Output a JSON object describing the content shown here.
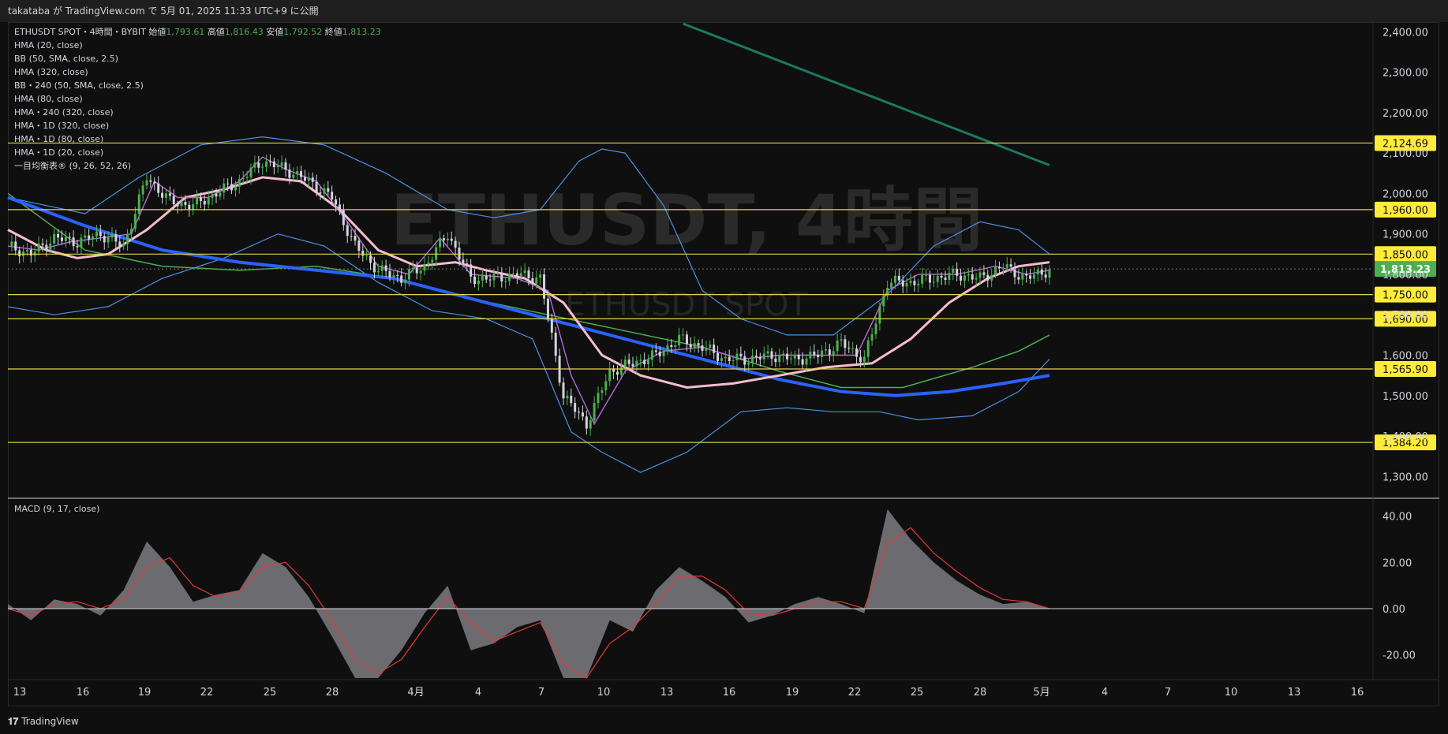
{
  "header": {
    "publisher_line": "takataba が TradingView.com で 5月 01, 2025 11:33 UTC+9 に公開"
  },
  "footer": {
    "brand": "TradingView"
  },
  "legend": {
    "symbol_line": "ETHUSDT SPOT・4時間・BYBIT",
    "open_label": "始値",
    "open": "1,793.61",
    "high_label": "高値",
    "high": "1,816.43",
    "low_label": "安値",
    "low": "1,792.52",
    "close_label": "終値",
    "close": "1,813.23",
    "indicators": [
      "HMA (20, close)",
      "BB (50, SMA, close, 2.5)",
      "HMA (320, close)",
      "BB・240 (50, SMA, close, 2.5)",
      "HMA (80, close)",
      "HMA・240 (320, close)",
      "HMA・1D (320, close)",
      "HMA・1D (80, close)",
      "HMA・1D (20, close)",
      "一目均衡表® (9, 26, 52, 26)"
    ]
  },
  "watermark": {
    "big": "ETHUSDT, 4時間",
    "small": "ETHUSDT SPOT"
  },
  "colors": {
    "up": "#26a69a",
    "upbody": "#4caf50",
    "down": "#d1d4dc",
    "hma20": "#b36ad6",
    "hma80_pink": "#f8bbd0",
    "hma320_blue": "#2962ff",
    "bb": "#4a90e2",
    "green_ma": "#4caf50",
    "teal_line": "#1b7a63",
    "hline": "#e6d54a",
    "price_label_bg": "#ffeb3b",
    "current_bg": "#4caf50"
  },
  "chart_data": [
    {
      "type": "candlestick",
      "title": "ETHUSDT SPOT・4時間・BYBIT",
      "ylim": [
        1250,
        2420
      ],
      "y_ticks": [
        "2,400.00",
        "2,300.00",
        "2,200.00",
        "2,100.00",
        "2,000.00",
        "1,900.00",
        "1,800.00",
        "1,700.00",
        "1,600.00",
        "1,500.00",
        "1,400.00",
        "1,300.00"
      ],
      "y_tick_values": [
        2400,
        2300,
        2200,
        2100,
        2000,
        1900,
        1800,
        1700,
        1600,
        1500,
        1400,
        1300
      ],
      "x_ticks": [
        "13",
        "16",
        "19",
        "22",
        "25",
        "28",
        "4月",
        "4",
        "7",
        "10",
        "13",
        "16",
        "19",
        "22",
        "25",
        "28",
        "5月",
        "4",
        "7",
        "10",
        "13",
        "16"
      ],
      "horizontal_levels": [
        {
          "value": 2124.69,
          "label": "2,124.69"
        },
        {
          "value": 1960.0,
          "label": "1,960.00"
        },
        {
          "value": 1850.0,
          "label": "1,850.00"
        },
        {
          "value": 1750.0,
          "label": "1,750.00"
        },
        {
          "value": 1690.0,
          "label": "1,690.00"
        },
        {
          "value": 1565.9,
          "label": "1,565.90"
        },
        {
          "value": 1384.2,
          "label": "1,384.20"
        }
      ],
      "current_price": {
        "value": 1813.23,
        "label": "1,813.23"
      },
      "close_path": [
        [
          0,
          1870
        ],
        [
          6,
          1850
        ],
        [
          12,
          1890
        ],
        [
          18,
          1880
        ],
        [
          24,
          1900
        ],
        [
          30,
          1870
        ],
        [
          36,
          2040
        ],
        [
          42,
          1980
        ],
        [
          48,
          1970
        ],
        [
          54,
          2000
        ],
        [
          60,
          2030
        ],
        [
          66,
          2080
        ],
        [
          72,
          2060
        ],
        [
          78,
          2030
        ],
        [
          84,
          1990
        ],
        [
          90,
          1870
        ],
        [
          96,
          1810
        ],
        [
          102,
          1790
        ],
        [
          108,
          1820
        ],
        [
          114,
          1900
        ],
        [
          120,
          1790
        ],
        [
          126,
          1790
        ],
        [
          132,
          1800
        ],
        [
          138,
          1790
        ],
        [
          144,
          1500
        ],
        [
          150,
          1430
        ],
        [
          156,
          1560
        ],
        [
          162,
          1580
        ],
        [
          168,
          1600
        ],
        [
          174,
          1640
        ],
        [
          180,
          1620
        ],
        [
          186,
          1590
        ],
        [
          192,
          1590
        ],
        [
          198,
          1600
        ],
        [
          204,
          1590
        ],
        [
          210,
          1600
        ],
        [
          216,
          1630
        ],
        [
          222,
          1590
        ],
        [
          228,
          1780
        ],
        [
          234,
          1780
        ],
        [
          240,
          1790
        ],
        [
          246,
          1800
        ],
        [
          252,
          1790
        ],
        [
          258,
          1820
        ],
        [
          264,
          1790
        ],
        [
          270,
          1812
        ]
      ],
      "hma20_path": [
        [
          0,
          1870
        ],
        [
          8,
          1860
        ],
        [
          16,
          1880
        ],
        [
          24,
          1890
        ],
        [
          32,
          1900
        ],
        [
          38,
          2030
        ],
        [
          44,
          1990
        ],
        [
          52,
          1990
        ],
        [
          60,
          2030
        ],
        [
          66,
          2090
        ],
        [
          72,
          2060
        ],
        [
          80,
          2030
        ],
        [
          88,
          1930
        ],
        [
          96,
          1820
        ],
        [
          104,
          1800
        ],
        [
          112,
          1890
        ],
        [
          120,
          1800
        ],
        [
          132,
          1790
        ],
        [
          140,
          1760
        ],
        [
          146,
          1550
        ],
        [
          152,
          1430
        ],
        [
          160,
          1560
        ],
        [
          170,
          1610
        ],
        [
          180,
          1620
        ],
        [
          190,
          1590
        ],
        [
          200,
          1600
        ],
        [
          210,
          1600
        ],
        [
          220,
          1600
        ],
        [
          228,
          1760
        ],
        [
          236,
          1800
        ],
        [
          246,
          1800
        ],
        [
          256,
          1820
        ],
        [
          264,
          1800
        ],
        [
          270,
          1810
        ]
      ],
      "hma80_path": [
        [
          0,
          1910
        ],
        [
          10,
          1860
        ],
        [
          18,
          1840
        ],
        [
          26,
          1850
        ],
        [
          36,
          1910
        ],
        [
          46,
          1990
        ],
        [
          56,
          2010
        ],
        [
          66,
          2040
        ],
        [
          76,
          2030
        ],
        [
          86,
          1960
        ],
        [
          96,
          1860
        ],
        [
          106,
          1820
        ],
        [
          116,
          1830
        ],
        [
          124,
          1810
        ],
        [
          134,
          1790
        ],
        [
          144,
          1730
        ],
        [
          154,
          1600
        ],
        [
          164,
          1550
        ],
        [
          176,
          1520
        ],
        [
          188,
          1530
        ],
        [
          200,
          1550
        ],
        [
          212,
          1570
        ],
        [
          224,
          1580
        ],
        [
          234,
          1640
        ],
        [
          244,
          1730
        ],
        [
          254,
          1790
        ],
        [
          262,
          1820
        ],
        [
          270,
          1830
        ]
      ],
      "hma320_path": [
        [
          0,
          1990
        ],
        [
          20,
          1920
        ],
        [
          40,
          1860
        ],
        [
          60,
          1830
        ],
        [
          80,
          1810
        ],
        [
          100,
          1790
        ],
        [
          120,
          1740
        ],
        [
          140,
          1690
        ],
        [
          160,
          1640
        ],
        [
          180,
          1590
        ],
        [
          200,
          1540
        ],
        [
          216,
          1510
        ],
        [
          230,
          1500
        ],
        [
          244,
          1510
        ],
        [
          258,
          1530
        ],
        [
          270,
          1550
        ]
      ],
      "green_ma_path": [
        [
          0,
          2000
        ],
        [
          20,
          1860
        ],
        [
          40,
          1820
        ],
        [
          60,
          1810
        ],
        [
          80,
          1820
        ],
        [
          100,
          1790
        ],
        [
          120,
          1740
        ],
        [
          140,
          1700
        ],
        [
          160,
          1660
        ],
        [
          180,
          1620
        ],
        [
          200,
          1560
        ],
        [
          216,
          1520
        ],
        [
          232,
          1520
        ],
        [
          250,
          1570
        ],
        [
          262,
          1610
        ],
        [
          270,
          1650
        ]
      ],
      "bb_upper_path": [
        [
          0,
          1990
        ],
        [
          20,
          1950
        ],
        [
          34,
          2040
        ],
        [
          50,
          2120
        ],
        [
          66,
          2140
        ],
        [
          82,
          2120
        ],
        [
          98,
          2050
        ],
        [
          114,
          1960
        ],
        [
          126,
          1940
        ],
        [
          138,
          1960
        ],
        [
          148,
          2080
        ],
        [
          154,
          2110
        ],
        [
          160,
          2100
        ],
        [
          170,
          1970
        ],
        [
          180,
          1760
        ],
        [
          190,
          1690
        ],
        [
          202,
          1650
        ],
        [
          214,
          1650
        ],
        [
          228,
          1750
        ],
        [
          240,
          1870
        ],
        [
          252,
          1930
        ],
        [
          262,
          1910
        ],
        [
          270,
          1850
        ]
      ],
      "bb_lower_path": [
        [
          0,
          1720
        ],
        [
          12,
          1700
        ],
        [
          26,
          1720
        ],
        [
          40,
          1790
        ],
        [
          56,
          1840
        ],
        [
          70,
          1900
        ],
        [
          82,
          1870
        ],
        [
          96,
          1780
        ],
        [
          110,
          1710
        ],
        [
          124,
          1690
        ],
        [
          136,
          1640
        ],
        [
          146,
          1410
        ],
        [
          154,
          1360
        ],
        [
          164,
          1310
        ],
        [
          176,
          1360
        ],
        [
          190,
          1460
        ],
        [
          202,
          1470
        ],
        [
          214,
          1460
        ],
        [
          226,
          1460
        ],
        [
          236,
          1440
        ],
        [
          250,
          1450
        ],
        [
          262,
          1510
        ],
        [
          270,
          1590
        ]
      ],
      "teal_line": [
        [
          175,
          2420
        ],
        [
          270,
          2070
        ]
      ],
      "macd_ylim": [
        -30,
        45
      ],
      "macd_ticks": [
        "40.00",
        "20.00",
        "0.00",
        "-20.00"
      ],
      "macd_tick_values": [
        40,
        20,
        0,
        -20
      ],
      "macd_hist": [
        [
          0,
          2
        ],
        [
          6,
          -5
        ],
        [
          12,
          4
        ],
        [
          18,
          2
        ],
        [
          24,
          -3
        ],
        [
          30,
          8
        ],
        [
          36,
          29
        ],
        [
          42,
          18
        ],
        [
          48,
          3
        ],
        [
          54,
          6
        ],
        [
          60,
          8
        ],
        [
          66,
          24
        ],
        [
          72,
          18
        ],
        [
          78,
          5
        ],
        [
          84,
          -12
        ],
        [
          90,
          -30
        ],
        [
          96,
          -30
        ],
        [
          102,
          -18
        ],
        [
          108,
          -2
        ],
        [
          114,
          10
        ],
        [
          120,
          -18
        ],
        [
          126,
          -15
        ],
        [
          132,
          -8
        ],
        [
          138,
          -5
        ],
        [
          144,
          -30
        ],
        [
          150,
          -30
        ],
        [
          156,
          -5
        ],
        [
          162,
          -10
        ],
        [
          168,
          8
        ],
        [
          174,
          18
        ],
        [
          180,
          12
        ],
        [
          186,
          5
        ],
        [
          192,
          -6
        ],
        [
          198,
          -3
        ],
        [
          204,
          2
        ],
        [
          210,
          5
        ],
        [
          216,
          2
        ],
        [
          222,
          -2
        ],
        [
          228,
          43
        ],
        [
          234,
          30
        ],
        [
          240,
          20
        ],
        [
          246,
          12
        ],
        [
          252,
          6
        ],
        [
          258,
          2
        ],
        [
          264,
          3
        ],
        [
          270,
          0
        ]
      ],
      "macd_signal": [
        [
          0,
          0
        ],
        [
          6,
          -3
        ],
        [
          12,
          2
        ],
        [
          18,
          3
        ],
        [
          24,
          0
        ],
        [
          30,
          4
        ],
        [
          36,
          18
        ],
        [
          42,
          22
        ],
        [
          48,
          10
        ],
        [
          54,
          5
        ],
        [
          60,
          7
        ],
        [
          66,
          18
        ],
        [
          72,
          20
        ],
        [
          78,
          10
        ],
        [
          84,
          -5
        ],
        [
          90,
          -22
        ],
        [
          96,
          -28
        ],
        [
          102,
          -22
        ],
        [
          108,
          -8
        ],
        [
          114,
          5
        ],
        [
          120,
          -6
        ],
        [
          126,
          -14
        ],
        [
          132,
          -10
        ],
        [
          138,
          -6
        ],
        [
          144,
          -24
        ],
        [
          150,
          -30
        ],
        [
          156,
          -15
        ],
        [
          162,
          -8
        ],
        [
          168,
          2
        ],
        [
          174,
          14
        ],
        [
          180,
          14
        ],
        [
          186,
          8
        ],
        [
          192,
          -2
        ],
        [
          198,
          -3
        ],
        [
          204,
          0
        ],
        [
          210,
          3
        ],
        [
          216,
          3
        ],
        [
          222,
          0
        ],
        [
          228,
          28
        ],
        [
          234,
          35
        ],
        [
          240,
          24
        ],
        [
          246,
          16
        ],
        [
          252,
          9
        ],
        [
          258,
          4
        ],
        [
          264,
          3
        ],
        [
          270,
          0
        ]
      ]
    }
  ],
  "macd": {
    "label": "MACD (9, 17, close)"
  }
}
